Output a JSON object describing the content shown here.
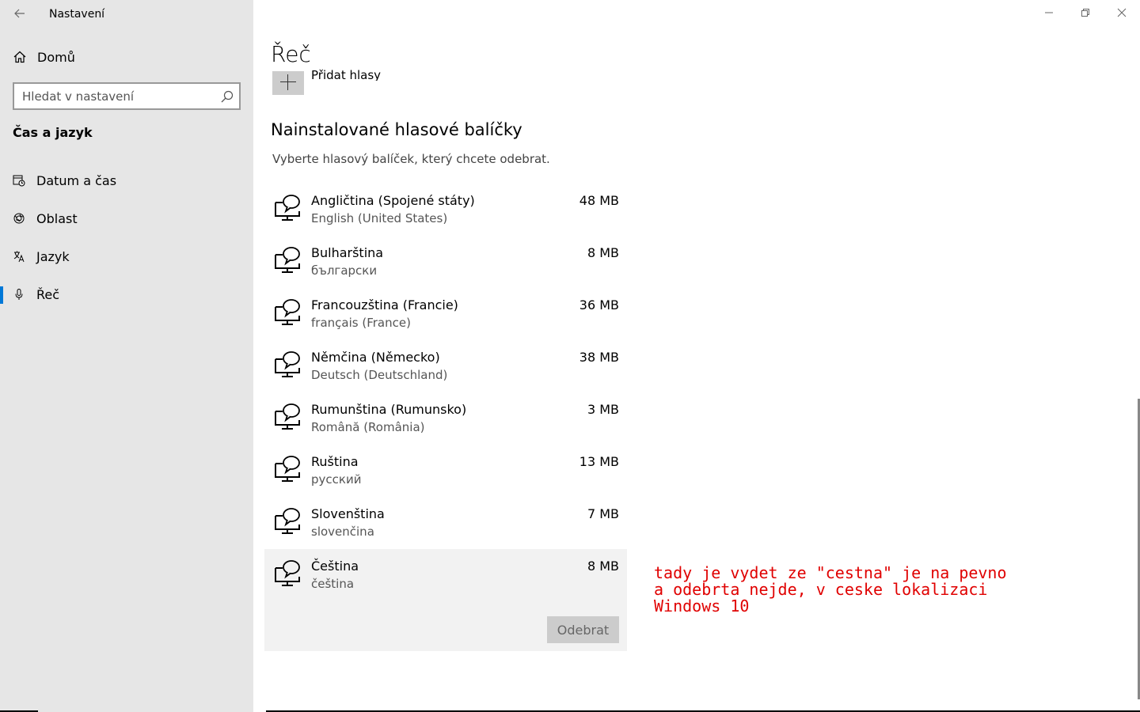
{
  "window": {
    "title": "Nastavení"
  },
  "sidebar": {
    "home_label": "Domů",
    "search_placeholder": "Hledat v nastavení",
    "section_heading": "Čas a jazyk",
    "items": [
      {
        "label": "Datum a čas",
        "icon": "clock-calendar-icon"
      },
      {
        "label": "Oblast",
        "icon": "globe-icon"
      },
      {
        "label": "Jazyk",
        "icon": "language-icon"
      },
      {
        "label": "Řeč",
        "icon": "microphone-icon",
        "active": true
      }
    ]
  },
  "main": {
    "title": "Řeč",
    "add_voices_label": "Přidat hlasy",
    "installed_heading": "Nainstalované hlasové balíčky",
    "installed_description": "Vyberte hlasový balíček, který chcete odebrat.",
    "voice_packs": [
      {
        "name": "Angličtina (Spojené státy)",
        "native": "English (United States)",
        "size": "48 MB"
      },
      {
        "name": "Bulharština",
        "native": "български",
        "size": "8 MB"
      },
      {
        "name": "Francouzština (Francie)",
        "native": "français (France)",
        "size": "36 MB"
      },
      {
        "name": "Němčina (Německo)",
        "native": "Deutsch (Deutschland)",
        "size": "38 MB"
      },
      {
        "name": "Rumunština (Rumunsko)",
        "native": "Română (România)",
        "size": "3 MB"
      },
      {
        "name": "Ruština",
        "native": "русский",
        "size": "13 MB"
      },
      {
        "name": "Slovenština",
        "native": "slovenčina",
        "size": "7 MB"
      },
      {
        "name": "Čeština",
        "native": "čeština",
        "size": "8 MB",
        "selected": true
      }
    ],
    "remove_button": "Odebrat"
  },
  "annotation": {
    "text": "tady je vydet ze \"cestna\" je na pevno\na odebrta nejde, v ceske lokalizaci\nWindows 10",
    "color": "#e00000"
  },
  "colors": {
    "accent": "#0078d7",
    "sidebar_bg": "#e6e6e6"
  }
}
